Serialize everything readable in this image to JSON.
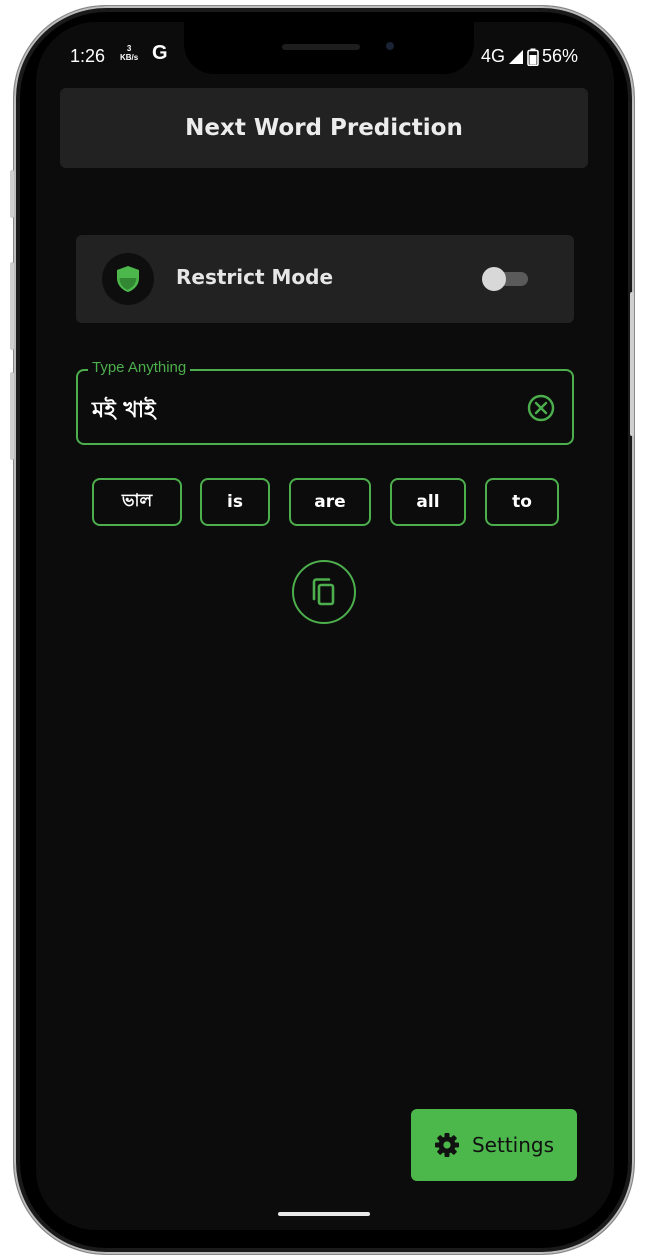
{
  "status_bar": {
    "time": "1:26",
    "speed_value": "3",
    "speed_unit": "KB/s",
    "app_icon": "G",
    "network": "4G",
    "battery": "56%"
  },
  "app_bar": {
    "title": "Next Word Prediction"
  },
  "restrict": {
    "label": "Restrict Mode",
    "enabled": false,
    "icon": "shield-icon"
  },
  "input": {
    "label": "Type Anything",
    "value": "মই খাই"
  },
  "suggestions": [
    "ভাল",
    "is",
    "are",
    "all",
    "to"
  ],
  "settings_button": {
    "label": "Settings",
    "icon": "gear-icon"
  },
  "colors": {
    "accent": "#4cae4c",
    "background": "#0c0c0c",
    "card": "#222222"
  }
}
